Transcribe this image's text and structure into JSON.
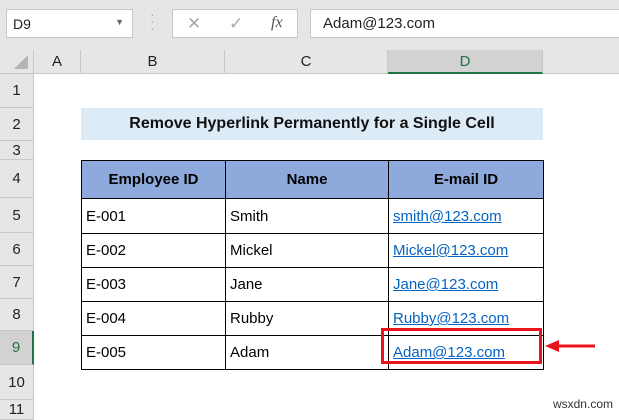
{
  "formula_bar": {
    "name_box": "D9",
    "cancel_icon": "✕",
    "enter_icon": "✓",
    "fx_label": "fx",
    "value": "Adam@123.com"
  },
  "columns": [
    "A",
    "B",
    "C",
    "D"
  ],
  "rows": [
    "1",
    "2",
    "3",
    "4",
    "5",
    "6",
    "7",
    "8",
    "9",
    "10",
    "11"
  ],
  "selected_cell": "D9",
  "title": "Remove Hyperlink Permanently for a Single Cell",
  "table": {
    "headers": [
      "Employee ID",
      "Name",
      "E-mail ID"
    ],
    "rows": [
      [
        "E-001",
        "Smith",
        "smith@123.com"
      ],
      [
        "E-002",
        "Mickel",
        "Mickel@123.com"
      ],
      [
        "E-003",
        "Jane",
        "Jane@123.com"
      ],
      [
        "E-004",
        "Rubby",
        "Rubby@123.com"
      ],
      [
        "E-005",
        "Adam",
        "Adam@123.com"
      ]
    ]
  },
  "colors": {
    "header_fill": "#8ea9db",
    "title_fill": "#ddebf7",
    "link": "#0563c1",
    "highlight": "#e8141c",
    "excel_green": "#217346"
  },
  "watermark": "wsxdn.com"
}
